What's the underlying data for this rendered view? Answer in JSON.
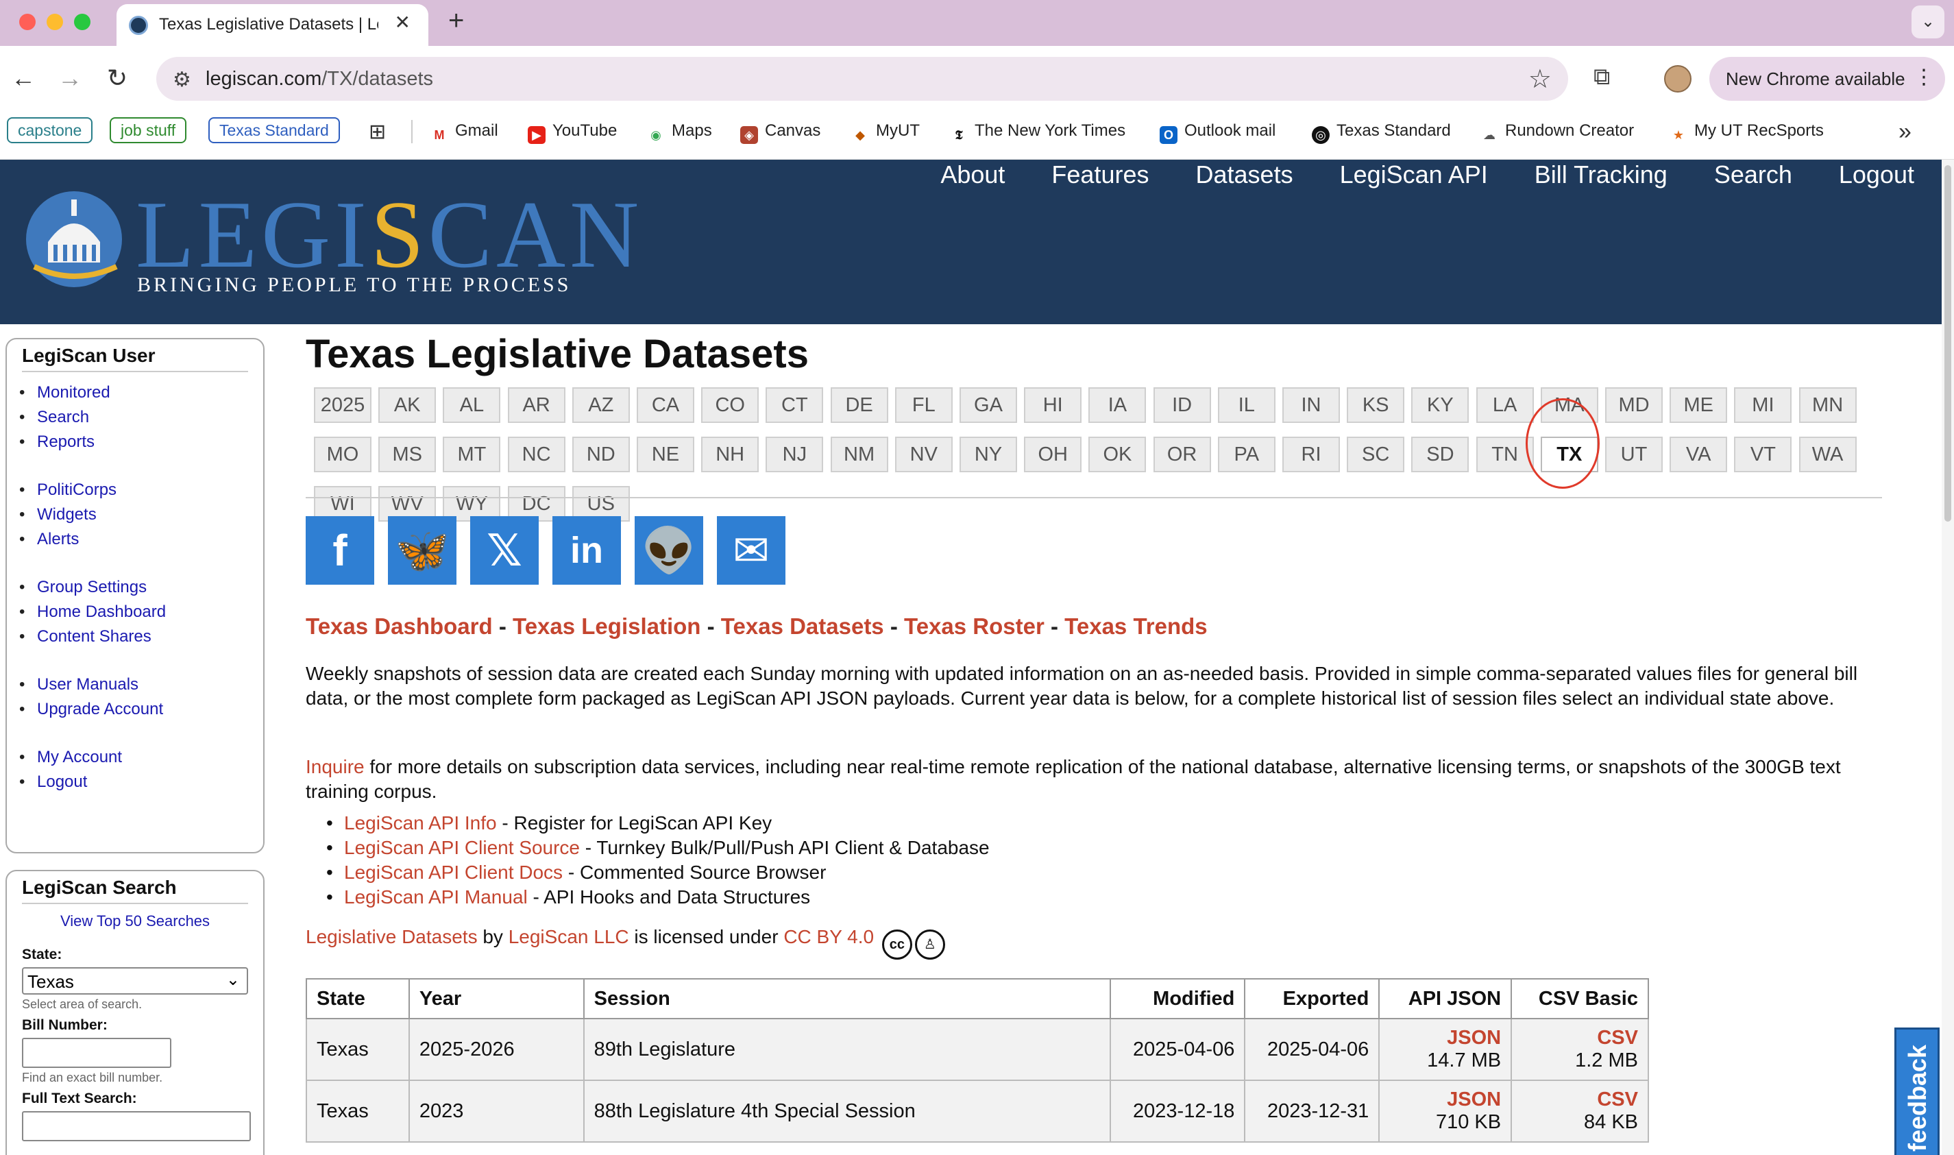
{
  "browser": {
    "tab_title": "Texas Legislative Datasets | LegiScan",
    "url_host": "legiscan.com",
    "url_path": "/TX/datasets",
    "update_label": "New Chrome available",
    "colors": {
      "tabbar": "#d9bfd9",
      "close": "#ff5f57",
      "minimize": "#febc2e",
      "maximize": "#28c840"
    }
  },
  "bookmarks": {
    "chips": [
      {
        "label": "capstone",
        "color": "#2a7f8a"
      },
      {
        "label": "job stuff",
        "color": "#2f8a2f"
      },
      {
        "label": "Texas Standard",
        "color": "#2f5fbf"
      }
    ],
    "items": [
      "Gmail",
      "YouTube",
      "Maps",
      "Canvas",
      "MyUT",
      "The New York Times",
      "Outlook mail",
      "Texas Standard",
      "Rundown Creator",
      "My UT RecSports"
    ]
  },
  "site": {
    "logo_prefix": "LEGI",
    "logo_s": "S",
    "logo_suffix": "CAN",
    "tagline": "BRINGING PEOPLE TO THE PROCESS",
    "nav": [
      "About",
      "Features",
      "Datasets",
      "LegiScan API",
      "Bill Tracking",
      "Search",
      "Logout"
    ]
  },
  "sidebar": {
    "user_title": "LegiScan User",
    "groups": [
      [
        "Monitored",
        "Search",
        "Reports"
      ],
      [
        "PolitiCorps",
        "Widgets",
        "Alerts"
      ],
      [
        "Group Settings",
        "Home Dashboard",
        "Content Shares"
      ],
      [
        "User Manuals",
        "Upgrade Account"
      ],
      [
        "My Account",
        "Logout"
      ]
    ],
    "search_title": "LegiScan Search",
    "top50": "View Top 50 Searches",
    "state_label": "State:",
    "state_value": "Texas",
    "state_hint": "Select area of search.",
    "bill_label": "Bill Number:",
    "bill_hint": "Find an exact bill number.",
    "fulltext_label": "Full Text Search:"
  },
  "main": {
    "title": "Texas Legislative Datasets",
    "states_row1": [
      "2025",
      "AK",
      "AL",
      "AR",
      "AZ",
      "CA",
      "CO",
      "CT",
      "DE",
      "FL",
      "GA",
      "HI",
      "IA",
      "ID",
      "IL",
      "IN",
      "KS",
      "KY",
      "LA",
      "MA",
      "MD",
      "ME",
      "MI",
      "MN"
    ],
    "states_row2": [
      "MO",
      "MS",
      "MT",
      "NC",
      "ND",
      "NE",
      "NH",
      "NJ",
      "NM",
      "NV",
      "NY",
      "OH",
      "OK",
      "OR",
      "PA",
      "RI",
      "SC",
      "SD",
      "TN",
      "TX",
      "UT",
      "VA",
      "VT",
      "WA"
    ],
    "states_row3": [
      "WI",
      "WV",
      "WY",
      "DC",
      "US"
    ],
    "active_state": "TX",
    "share_icons": [
      "facebook-icon",
      "bluesky-icon",
      "x-icon",
      "linkedin-icon",
      "reddit-icon",
      "email-icon"
    ],
    "state_links": [
      "Texas Dashboard",
      "Texas Legislation",
      "Texas Datasets",
      "Texas Roster",
      "Texas Trends"
    ],
    "para1": "Weekly snapshots of session data are created each Sunday morning with updated information on an as-needed basis. Provided in simple comma-separated values files for general bill data, or the most complete form packaged as LegiScan API JSON payloads. Current year data is below, for a complete historical list of session files select an individual state above.",
    "para2_link": "Inquire",
    "para2": " for more details on subscription data services, including near real-time remote replication of the national database, alternative licensing terms, or snapshots of the 300GB text training corpus.",
    "api_links": [
      {
        "link": "LegiScan API Info",
        "desc": " - Register for LegiScan API Key"
      },
      {
        "link": "LegiScan API Client Source",
        "desc": " - Turnkey Bulk/Pull/Push API Client & Database"
      },
      {
        "link": "LegiScan API Client Docs",
        "desc": " - Commented Source Browser"
      },
      {
        "link": "LegiScan API Manual",
        "desc": " - API Hooks and Data Structures"
      }
    ],
    "license": {
      "datasets": "Legislative Datasets",
      "by": " by ",
      "org": "LegiScan LLC",
      "licensed": " is licensed under ",
      "cc": "CC BY 4.0"
    },
    "table": {
      "headers": [
        "State",
        "Year",
        "Session",
        "Modified",
        "Exported",
        "API JSON",
        "CSV Basic"
      ],
      "rows": [
        {
          "state": "Texas",
          "year": "2025-2026",
          "session": "89th Legislature",
          "modified": "2025-04-06",
          "exported": "2025-04-06",
          "json": "JSON",
          "json_size": "14.7 MB",
          "csv": "CSV",
          "csv_size": "1.2 MB"
        },
        {
          "state": "Texas",
          "year": "2023",
          "session": "88th Legislature 4th Special Session",
          "modified": "2023-12-18",
          "exported": "2023-12-31",
          "json": "JSON",
          "json_size": "710 KB",
          "csv": "CSV",
          "csv_size": "84 KB"
        }
      ]
    },
    "feedback": "feedback"
  }
}
